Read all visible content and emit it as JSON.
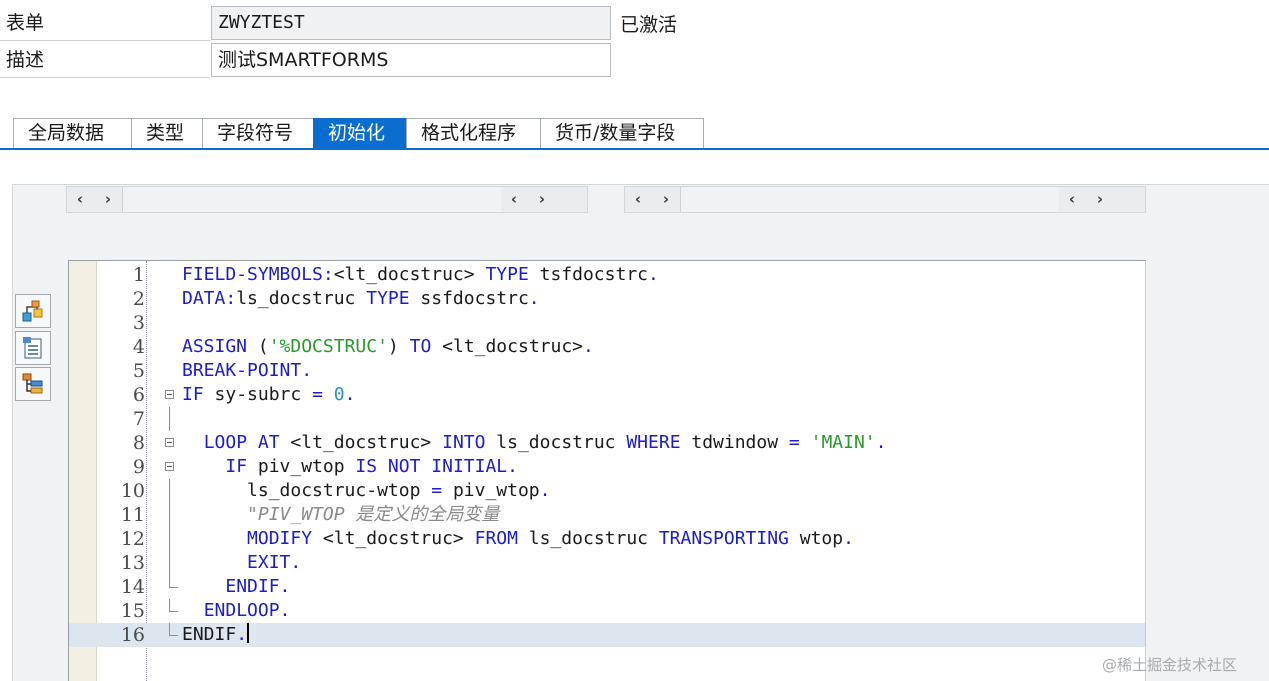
{
  "header": {
    "form_label": "表单",
    "form_value": "ZWYZTEST",
    "status": "已激活",
    "desc_label": "描述",
    "desc_value": "测试SMARTFORMS"
  },
  "tabs": [
    {
      "label": "全局数据",
      "active": false
    },
    {
      "label": "类型",
      "active": false
    },
    {
      "label": "字段符号",
      "active": false
    },
    {
      "label": "初始化",
      "active": true
    },
    {
      "label": "格式化程序",
      "active": false
    },
    {
      "label": "货币/数量字段",
      "active": false
    }
  ],
  "scrollbars": {
    "left_arrow": "‹",
    "right_arrow": "›"
  },
  "toolbar_icons": [
    "tree-hierarchy-icon",
    "document-list-icon",
    "structure-icon"
  ],
  "editor": {
    "current_line": 16,
    "lines": [
      {
        "no": "1",
        "fold": "none",
        "tokens": [
          [
            "kw",
            "FIELD-SYMBOLS:"
          ],
          [
            "id",
            "<lt_docstruc> "
          ],
          [
            "kw",
            "TYPE "
          ],
          [
            "id",
            "tsfdocstrc"
          ],
          [
            "kw",
            "."
          ]
        ]
      },
      {
        "no": "2",
        "fold": "none",
        "tokens": [
          [
            "kw",
            "DATA:"
          ],
          [
            "id",
            "ls_docstruc "
          ],
          [
            "kw",
            "TYPE "
          ],
          [
            "id",
            "ssfdocstrc"
          ],
          [
            "kw",
            "."
          ]
        ]
      },
      {
        "no": "3",
        "fold": "none",
        "tokens": []
      },
      {
        "no": "4",
        "fold": "none",
        "tokens": [
          [
            "kw",
            "ASSIGN "
          ],
          [
            "id",
            "("
          ],
          [
            "str",
            "'%DOCSTRUC'"
          ],
          [
            "id",
            ") "
          ],
          [
            "kw",
            "TO "
          ],
          [
            "id",
            "<lt_docstruc>"
          ],
          [
            "kw",
            "."
          ]
        ]
      },
      {
        "no": "5",
        "fold": "none",
        "tokens": [
          [
            "kw",
            "BREAK-POINT."
          ]
        ]
      },
      {
        "no": "6",
        "fold": "open",
        "tokens": [
          [
            "kw",
            "IF "
          ],
          [
            "id",
            "sy-subrc "
          ],
          [
            "op",
            "= "
          ],
          [
            "num",
            "0"
          ],
          [
            "kw",
            "."
          ]
        ]
      },
      {
        "no": "7",
        "fold": "line",
        "tokens": []
      },
      {
        "no": "8",
        "fold": "open",
        "tokens": [
          [
            "id",
            "  "
          ],
          [
            "kw",
            "LOOP AT "
          ],
          [
            "id",
            "<lt_docstruc> "
          ],
          [
            "kw",
            "INTO "
          ],
          [
            "id",
            "ls_docstruc "
          ],
          [
            "kw",
            "WHERE "
          ],
          [
            "id",
            "tdwindow "
          ],
          [
            "op",
            "= "
          ],
          [
            "str",
            "'MAIN'"
          ],
          [
            "kw",
            "."
          ]
        ]
      },
      {
        "no": "9",
        "fold": "open",
        "tokens": [
          [
            "id",
            "    "
          ],
          [
            "kw",
            "IF "
          ],
          [
            "id",
            "piv_wtop "
          ],
          [
            "kw",
            "IS NOT INITIAL."
          ]
        ]
      },
      {
        "no": "10",
        "fold": "line",
        "tokens": [
          [
            "id",
            "      ls_docstruc-wtop "
          ],
          [
            "op",
            "= "
          ],
          [
            "id",
            "piv_wtop"
          ],
          [
            "kw",
            "."
          ]
        ]
      },
      {
        "no": "11",
        "fold": "line",
        "tokens": [
          [
            "cmt",
            "      \"PIV_WTOP 是定义的全局变量"
          ]
        ]
      },
      {
        "no": "12",
        "fold": "line",
        "tokens": [
          [
            "id",
            "      "
          ],
          [
            "kw",
            "MODIFY "
          ],
          [
            "id",
            "<lt_docstruc> "
          ],
          [
            "kw",
            "FROM "
          ],
          [
            "id",
            "ls_docstruc "
          ],
          [
            "kw",
            "TRANSPORTING "
          ],
          [
            "id",
            "wtop"
          ],
          [
            "kw",
            "."
          ]
        ]
      },
      {
        "no": "13",
        "fold": "line",
        "tokens": [
          [
            "id",
            "      "
          ],
          [
            "kw",
            "EXIT."
          ]
        ]
      },
      {
        "no": "14",
        "fold": "end",
        "tokens": [
          [
            "id",
            "    "
          ],
          [
            "kw",
            "ENDIF."
          ]
        ]
      },
      {
        "no": "15",
        "fold": "end",
        "tokens": [
          [
            "id",
            "  "
          ],
          [
            "kw",
            "ENDLOOP."
          ]
        ]
      },
      {
        "no": "16",
        "fold": "end",
        "tokens": [
          [
            "id",
            "ENDIF"
          ],
          [
            "kw",
            "."
          ]
        ]
      }
    ]
  },
  "watermark": "@稀土掘金技术社区"
}
